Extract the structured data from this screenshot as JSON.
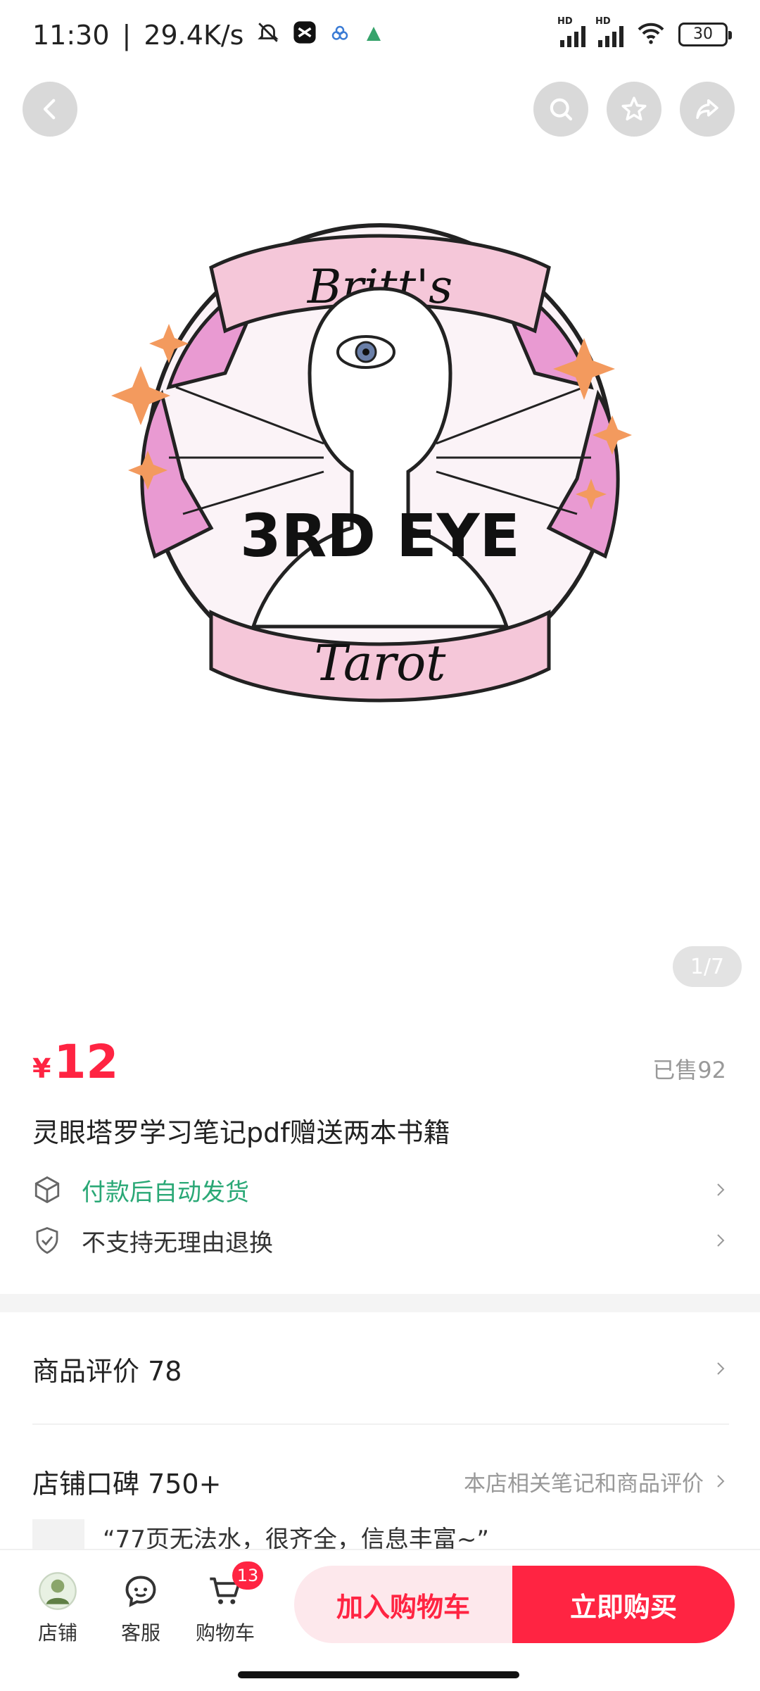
{
  "status_bar": {
    "time": "11:30",
    "separator": "|",
    "speed": "29.4K/s",
    "battery": "30"
  },
  "nav": {
    "icons": [
      "back-icon",
      "search-icon",
      "star-icon",
      "share-icon"
    ]
  },
  "hero": {
    "logo_text": {
      "top_banner": "Britt's",
      "center": "3RD EYE",
      "bottom_banner": "Tarot"
    },
    "page_indicator": "1/7",
    "colors": {
      "pink": "#e99ad2",
      "banner": "#f5c7d9",
      "spark": "#f39a5e"
    }
  },
  "product": {
    "currency": "¥",
    "price": "12",
    "sold": "已售92",
    "title": "灵眼塔罗学习笔记pdf赠送两本书籍",
    "delivery": "付款后自动发货",
    "return_policy": "不支持无理由退换"
  },
  "reviews": {
    "label": "商品评价 78"
  },
  "store": {
    "label": "店铺口碑 750+",
    "extra": "本店相关笔记和商品评价",
    "snippet": "“77页无法水，很齐全，信息丰富~”"
  },
  "bottom_bar": {
    "shop_label": "店铺",
    "service_label": "客服",
    "cart_label": "购物车",
    "cart_badge": "13",
    "add_to_cart": "加入购物车",
    "buy_now": "立即购买"
  },
  "colors": {
    "accent": "#ff2442",
    "green": "#2aa876"
  }
}
